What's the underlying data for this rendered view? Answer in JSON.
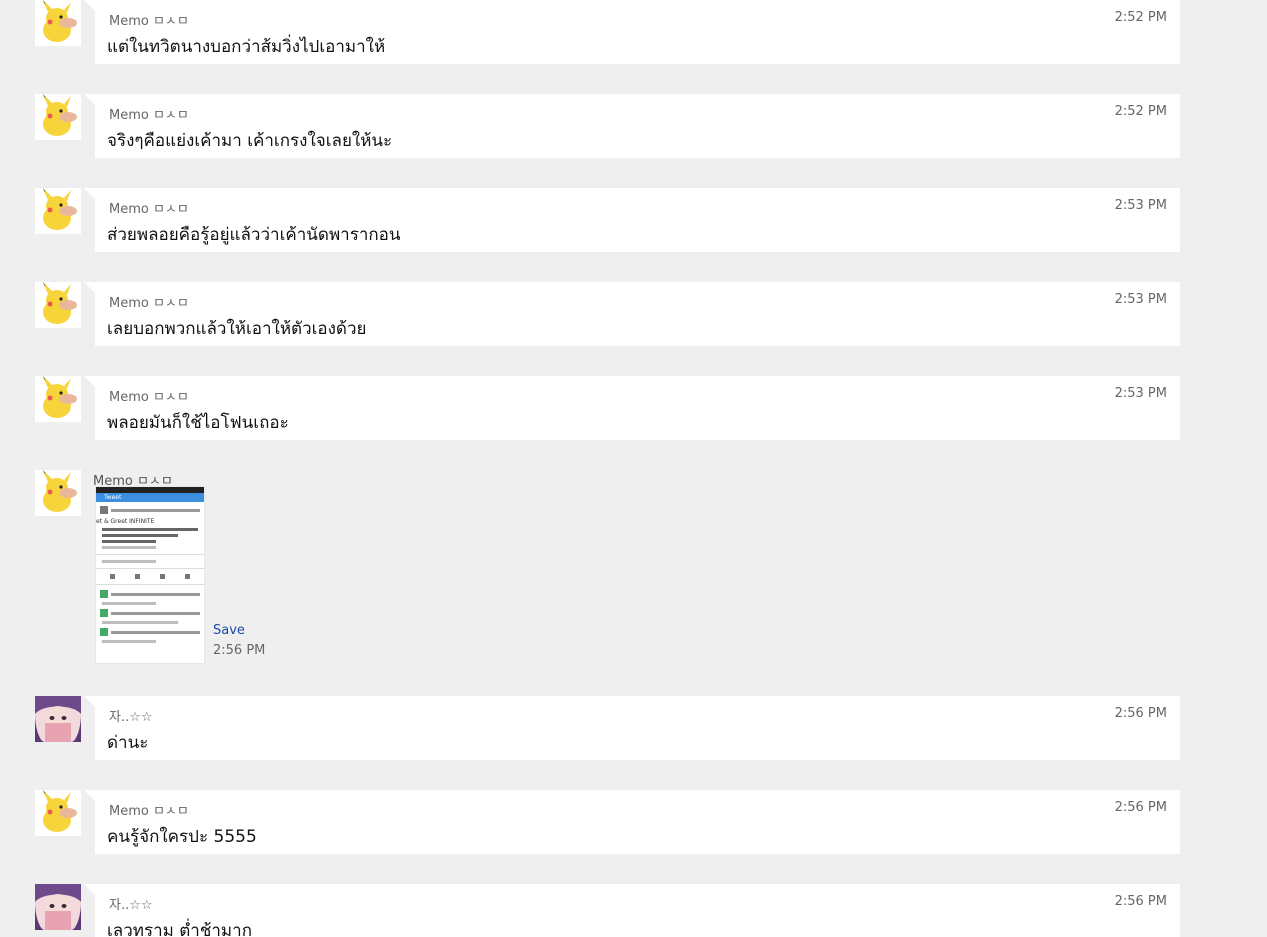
{
  "messages": [
    {
      "sender": "Memo ㅁㅅㅁ",
      "time": "2:52 PM",
      "text": "แต่ในทวิตนางบอกว่าส้มวิ่งไปเอามาให้",
      "avatar": "pikachu-avatar"
    },
    {
      "sender": "Memo ㅁㅅㅁ",
      "time": "2:52 PM",
      "text": "จริงๆคือแย่งเค้ามา เค้าเกรงใจเลยให้นะ",
      "avatar": "pikachu-avatar"
    },
    {
      "sender": "Memo ㅁㅅㅁ",
      "time": "2:53 PM",
      "text": "ส่วยพลอยคือรู้อยู่แล้วว่าเค้านัดพารากอน",
      "avatar": "pikachu-avatar"
    },
    {
      "sender": "Memo ㅁㅅㅁ",
      "time": "2:53 PM",
      "text": "เลยบอกพวกแล้วให้เอาให้ตัวเองด้วย",
      "avatar": "pikachu-avatar"
    },
    {
      "sender": "Memo ㅁㅅㅁ",
      "time": "2:53 PM",
      "text": "พลอยมันก็ใช้ไอโฟนเถอะ",
      "avatar": "pikachu-avatar"
    }
  ],
  "image_message": {
    "sender": "Memo ㅁㅅㅁ",
    "save_label": "Save",
    "time": "2:56 PM",
    "thumb_title": "Tweet",
    "thumb_subtitle": "et & Greet INFINITE"
  },
  "messages_after": [
    {
      "sender": "자..☆☆",
      "time": "2:56 PM",
      "text": "ด่านะ",
      "avatar": "girl-avatar"
    },
    {
      "sender": "Memo ㅁㅅㅁ",
      "time": "2:56 PM",
      "text": "คนรู้จักใครปะ 5555",
      "avatar": "pikachu-avatar"
    },
    {
      "sender": "자..☆☆",
      "time": "2:56 PM",
      "text": "เลวทราม ต่ำช้ามาก",
      "avatar": "girl-avatar"
    }
  ],
  "colors": {
    "background": "#efefef",
    "bubble": "#ffffff",
    "link": "#1a4aa8"
  }
}
